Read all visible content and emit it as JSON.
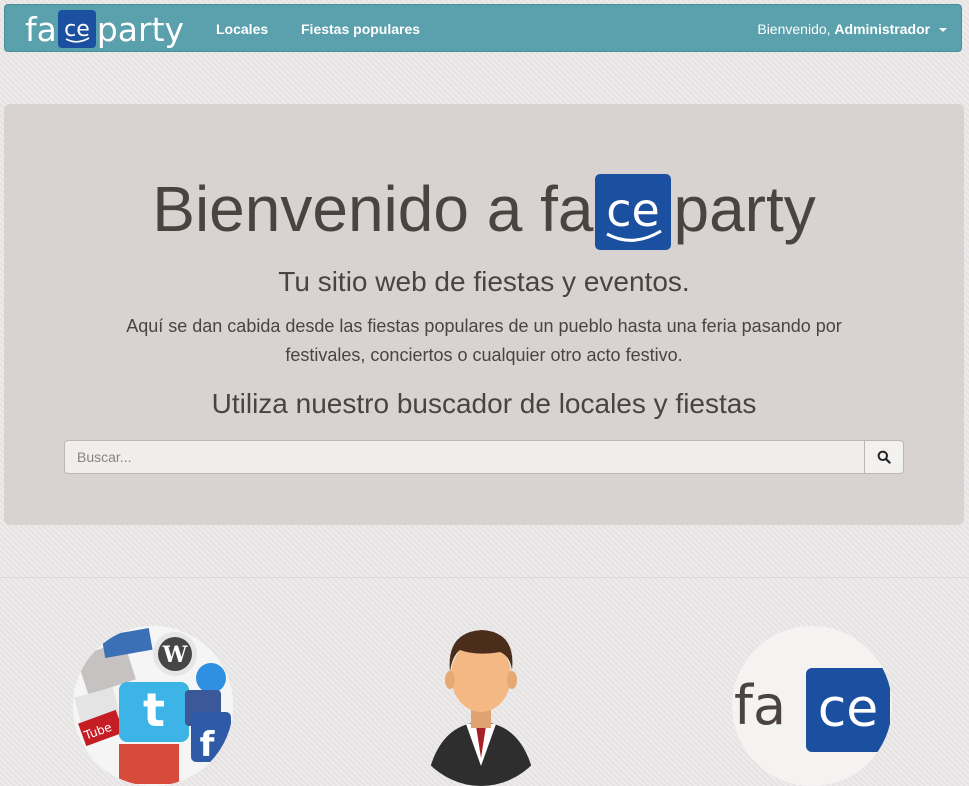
{
  "navbar": {
    "brand": {
      "prefix": "fa",
      "logo": "ce",
      "suffix": "party"
    },
    "links": [
      {
        "label": "Locales"
      },
      {
        "label": "Fiestas populares"
      }
    ],
    "user": {
      "greeting": "Bienvenido,",
      "name": "Administrador"
    }
  },
  "hero": {
    "title_prefix": "Bienvenido a fa",
    "title_logo": "ce",
    "title_suffix": "party",
    "subtitle": "Tu sitio web de fiestas y eventos.",
    "description_line1": "Aquí se dan cabida desde las fiestas populares de un pueblo hasta una feria pasando por",
    "description_line2": "festivales, conciertos o cualquier otro acto festivo.",
    "search_title": "Utiliza nuestro buscador de locales y fiestas",
    "search": {
      "placeholder": "Buscar...",
      "value": "",
      "button_icon": "search-icon"
    }
  },
  "features": [
    {
      "image": "social-media-icons-image"
    },
    {
      "image": "businessman-avatar-image"
    },
    {
      "image": "faceparty-logo-image",
      "logo_text_prefix": "fa",
      "logo_text_box": "ce"
    }
  ],
  "colors": {
    "navbar": "#5aa0ad",
    "logo_blue": "#1b4fa0",
    "hero_bg": "#d8d3d1",
    "text": "#4b4340"
  }
}
